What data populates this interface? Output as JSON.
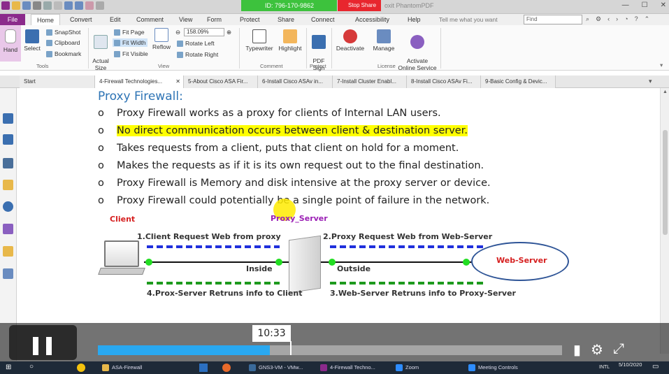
{
  "titlebar": {
    "zoom_meeting_id": "ID: 796-170-9862",
    "zoom_stop_share": "Stop Share",
    "app_title": "oxit PhantomPDF"
  },
  "menu": {
    "file": "File",
    "tabs": [
      "Home",
      "Convert",
      "Edit",
      "Comment",
      "View",
      "Form",
      "Protect",
      "Share",
      "Connect",
      "Accessibility",
      "Help"
    ],
    "tell_me": "Tell me what you want",
    "find_placeholder": "Find"
  },
  "ribbon": {
    "hand": "Hand",
    "select": "Select",
    "snapshot": "SnapShot",
    "clipboard": "Clipboard",
    "bookmark": "Bookmark",
    "actual_size": "Actual\nSize",
    "fit_page": "Fit Page",
    "fit_width": "Fit Width",
    "fit_visible": "Fit Visible",
    "reflow": "Reflow",
    "zoom_value": "158.09%",
    "rotate_left": "Rotate Left",
    "rotate_right": "Rotate Right",
    "typewriter": "Typewriter",
    "highlight": "Highlight",
    "pdf_sign": "PDF\nSign",
    "deactivate": "Deactivate",
    "manage": "Manage",
    "activate": "Activate\nOnline Service",
    "groups": {
      "tools": "Tools",
      "view": "View",
      "comment": "Comment",
      "protect": "Protect",
      "license": "License"
    }
  },
  "doc_tabs": [
    "Start",
    "4-Firewall Technologies...",
    "5-About Cisco ASA Fir...",
    "6-Install Cisco ASAv in...",
    "7-Install Cluster Enabl...",
    "8-Install Cisco ASAv Fi...",
    "9-Basic Config & Devic..."
  ],
  "document": {
    "title": "Proxy Firewall:",
    "bullet_marker": "o",
    "bullets": [
      "Proxy Firewall works as a proxy for clients of Internal LAN users.",
      "No direct communication occurs between client & destination server.",
      "Takes requests from a client, puts that client on hold for a moment.",
      "Makes the requests as if it is its own request out to the final destination.",
      "Proxy Firewall is Memory and disk intensive at the proxy server or device.",
      "Proxy Firewall could potentially be a single point of failure in the network."
    ],
    "highlighted_index": 1,
    "diagram": {
      "client": "Client",
      "proxy_server": "Proxy_Server",
      "step1": "1.Client Request Web from proxy",
      "step2": "2.Proxy Request Web from Web-Server",
      "step3": "3.Web-Server Retruns info to Proxy-Server",
      "step4": "4.Prox-Server Retruns info to Client",
      "inside": "Inside",
      "outside": "Outside",
      "web_server": "Web-Server"
    }
  },
  "video": {
    "time": "10:33",
    "progress": 0.37
  },
  "taskbar": {
    "items": [
      "ASA-Firewall",
      "GNS3-VM - VMw...",
      "4-Firewall Techno...",
      "Zoom",
      "Meeting Controls"
    ],
    "lang": "INTL",
    "date": "5/10/2020"
  },
  "colors": {
    "file_tab": "#8b2a8b",
    "title_blue": "#2e74b5",
    "highlight": "#ffff00",
    "client_red": "#d62020",
    "proxy_purple": "#9b1fb5",
    "progress": "#29a8f0"
  }
}
